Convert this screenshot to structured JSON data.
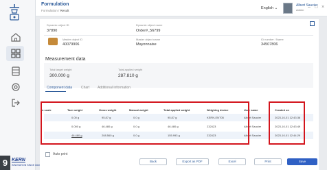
{
  "header": {
    "title": "Formulation",
    "breadcrumb_parent": "Formulation",
    "breadcrumb_sep": "/",
    "breadcrumb_current": "Result",
    "language": "English",
    "user_name": "Albert Saucier",
    "user_role": "Admin",
    "minimize": "–",
    "maximize": "□",
    "close": "×"
  },
  "details": {
    "dynamic_object_label": "Dynamic object ID",
    "dynamic_object_value": "37890",
    "dynamic_name_label": "Dynamic object name",
    "dynamic_name_value": "Order#_56799",
    "master_id_label": "Master object ID",
    "master_id_value": "40079906",
    "master_name_label": "Master object name",
    "master_name_value": "Mayonnaise",
    "barcode_label": "ID number / Name",
    "barcode_value": "34507806"
  },
  "measurement": {
    "section_title": "Measurement data",
    "target_label": "Total target weight",
    "target_value": "300.000 g",
    "applied_label": "Total applied weight",
    "applied_value": "287.810 g"
  },
  "tabs": [
    "Component data",
    "Chart",
    "Additional information"
  ],
  "table": {
    "columns": [
      "n scale",
      "Tare weight",
      "Gross weight",
      "Manual weight",
      "Total applied weight",
      "Weighing device",
      "User name",
      "Created on"
    ],
    "rows": [
      [
        "",
        "0.00 g",
        "95.87 g",
        "0.0 g",
        "95.87 g",
        "KERN-ENT05",
        "Albert Saucier",
        "2023-10-01 12:43:36"
      ],
      [
        "",
        "0.000 g",
        "46.480 g",
        "0.0 g",
        "46.480 g",
        "232423",
        "Albert Saucier",
        "2023-10-01 12:43:49"
      ],
      [
        "",
        "46.480 g",
        "208.560 g",
        "0.0 g",
        "155.993 g",
        "232423",
        "Albert Saucier",
        "2023-10-01 12:44:29"
      ]
    ]
  },
  "footer": {
    "auto_print": "Auto print",
    "buttons": [
      "Back",
      "Export as PDF",
      "Excel",
      "Print",
      "Save"
    ]
  },
  "badge": {
    "step": "9",
    "brand": "KERN",
    "brand_sub": "INNOVATION SINCE 1844"
  }
}
